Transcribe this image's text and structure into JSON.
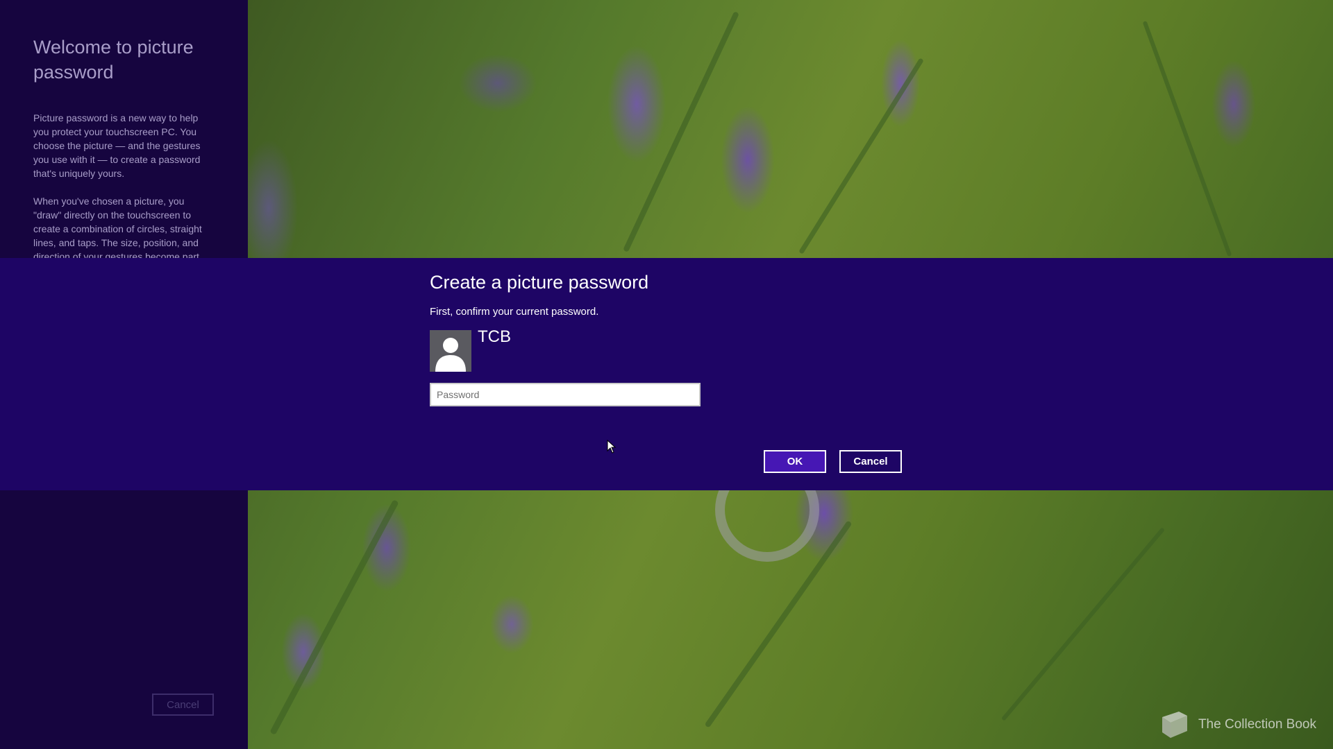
{
  "left_panel": {
    "title": "Welcome to picture password",
    "paragraph1": "Picture password is a new way to help you protect your touchscreen PC. You choose the picture — and the gestures you use with it — to create a password that's uniquely yours.",
    "paragraph2": "When you've chosen a picture, you \"draw\" directly on the touchscreen to create a combination of circles, straight lines, and taps. The size, position, and direction of your gestures become part",
    "cancel_label": "Cancel"
  },
  "dialog": {
    "title": "Create a picture password",
    "subtitle": "First, confirm your current password.",
    "username": "TCB",
    "password_placeholder": "Password",
    "password_value": "",
    "ok_label": "OK",
    "cancel_label": "Cancel"
  },
  "watermark": {
    "text": "The Collection Book",
    "icon": "book-icon"
  },
  "icons": {
    "avatar": "user-silhouette-icon",
    "refresh": "refresh-arrows-icon",
    "cursor": "mouse-cursor-icon"
  },
  "colors": {
    "dialog_band": "#1e0565",
    "left_panel": "#16053f",
    "ok_button": "#4617b4",
    "text_primary": "#ffffff",
    "text_muted": "#a99ec9"
  }
}
